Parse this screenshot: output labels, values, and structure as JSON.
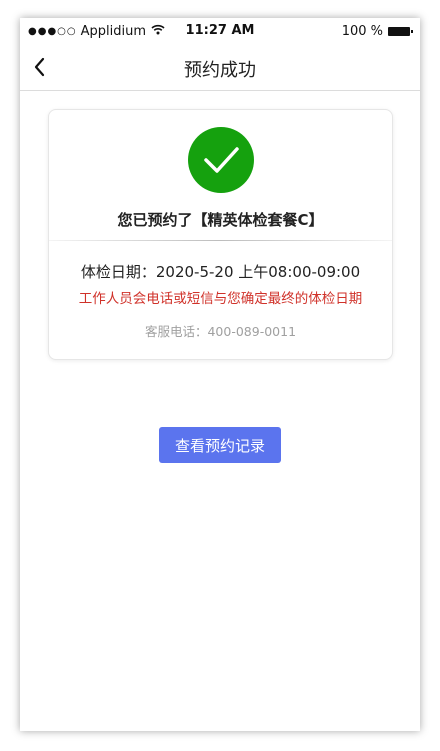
{
  "status_bar": {
    "signal": "●●●○○",
    "carrier": "Applidium",
    "time": "11:27 AM",
    "battery_label": "100 %"
  },
  "nav": {
    "title": "预约成功"
  },
  "card": {
    "booked_text": "您已预约了【精英体检套餐C】",
    "exam_date": "体检日期：2020-5-20  上午08:00-09:00",
    "notice": "工作人员会电话或短信与您确定最终的体检日期",
    "service_phone": "客服电话：400-089-0011"
  },
  "actions": {
    "view_records": "查看预约记录"
  },
  "colors": {
    "success": "#15a10e",
    "primary_button": "#5b74ee",
    "notice_red": "#d0322a"
  }
}
